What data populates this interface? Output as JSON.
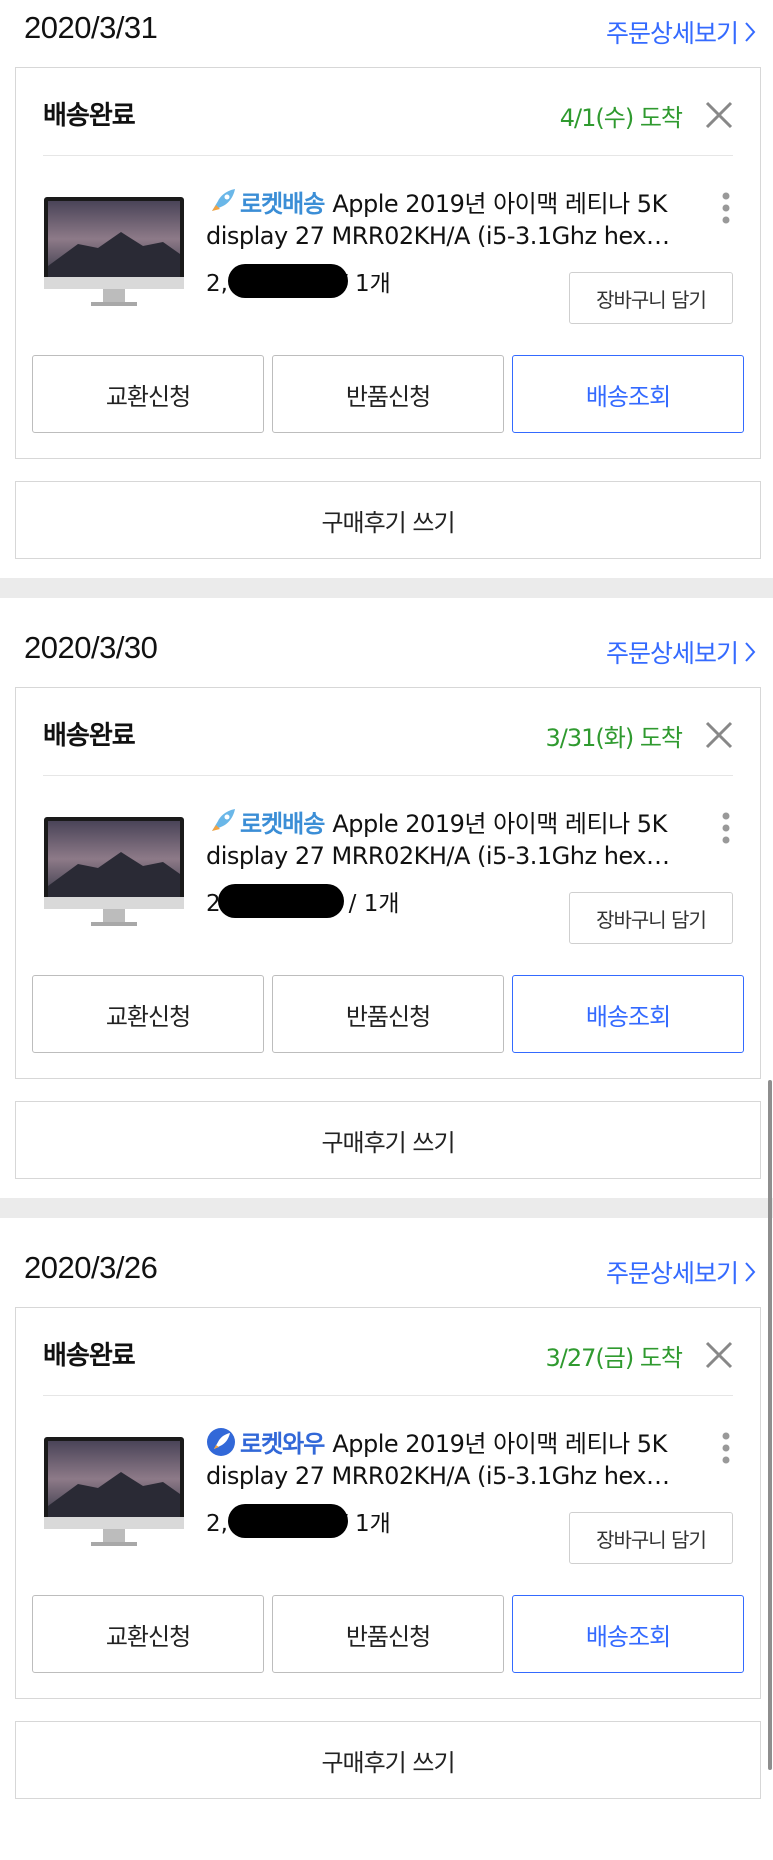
{
  "orders": [
    {
      "date": "2020/3/31",
      "detail_link": "주문상세보기",
      "status": "배송완료",
      "arrival": "4/1(수) 도착",
      "badge": "로켓배송",
      "badge_type": "rocket",
      "title_line1": "Apple 2019년 아이맥 레티나 5K",
      "title_line2": "display 27 MRR02KH/A (i5-3.1Ghz hex…",
      "price_prefix": "2,",
      "qty": "/ 1개",
      "cart_button": "장바구니 담기",
      "buttons": [
        "교환신청",
        "반품신청",
        "배송조회"
      ],
      "review_button": "구매후기 쓰기"
    },
    {
      "date": "2020/3/30",
      "detail_link": "주문상세보기",
      "status": "배송완료",
      "arrival": "3/31(화) 도착",
      "badge": "로켓배송",
      "badge_type": "rocket",
      "title_line1": "Apple 2019년 아이맥 레티나 5K",
      "title_line2": "display 27 MRR02KH/A (i5-3.1Ghz hex…",
      "price_prefix": "2",
      "qty": "/ 1개",
      "cart_button": "장바구니 담기",
      "buttons": [
        "교환신청",
        "반품신청",
        "배송조회"
      ],
      "review_button": "구매후기 쓰기"
    },
    {
      "date": "2020/3/26",
      "detail_link": "주문상세보기",
      "status": "배송완료",
      "arrival": "3/27(금) 도착",
      "badge": "로켓와우",
      "badge_type": "wow",
      "title_line1": "Apple 2019년 아이맥 레티나 5K",
      "title_line2": "display 27 MRR02KH/A (i5-3.1Ghz hex…",
      "price_prefix": "2,",
      "qty": "/ 1개",
      "cart_button": "장바구니 담기",
      "buttons": [
        "교환신청",
        "반품신청",
        "배송조회"
      ],
      "review_button": "구매후기 쓰기"
    }
  ],
  "colors": {
    "link_blue": "#346aff",
    "arrival_green": "#2f9a2f",
    "rocket_blue": "#3b8ed6",
    "separator": "#ebebeb"
  }
}
